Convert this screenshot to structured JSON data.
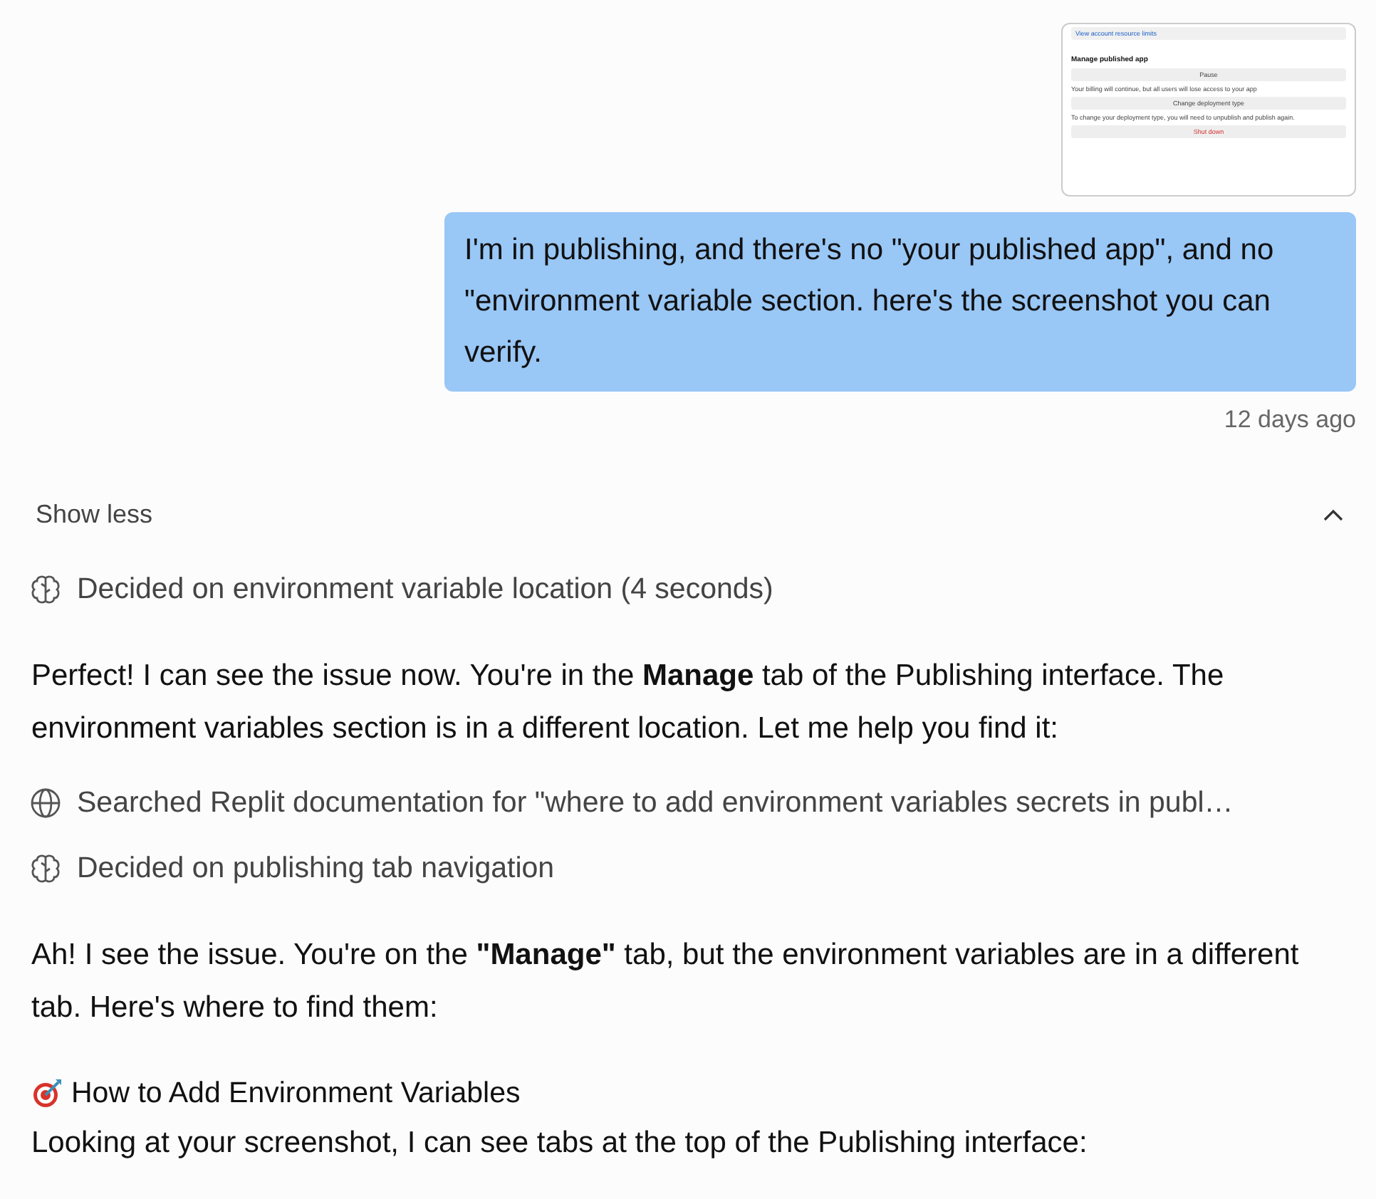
{
  "attachment": {
    "link": "View account resource limits",
    "heading": "Manage published app",
    "items": [
      {
        "button": "Pause",
        "note": "Your billing will continue, but all users will lose access to your app"
      },
      {
        "button": "Change deployment type",
        "note": "To change your deployment type, you will need to unpublish and publish again."
      },
      {
        "button": "Shut down",
        "danger": true
      }
    ]
  },
  "user_message": {
    "text": "I'm in publishing, and there's no \"your published app\", and no \"environment variable section. here's the screenshot you can verify.",
    "time": "12 days ago"
  },
  "toggle": {
    "label": "Show less",
    "expanded": true
  },
  "steps": [
    {
      "kind": "thought",
      "text": "Decided on environment variable location (4 seconds)"
    },
    {
      "kind": "paragraph",
      "text": "Perfect! I can see the issue now. You're in the **Manage** tab of the Publishing interface. The environment variables section is in a different location. Let me help you find it:"
    },
    {
      "kind": "search",
      "text": "Searched Replit documentation for \"where to add environment variables secrets in publ…"
    },
    {
      "kind": "thought",
      "text": "Decided on publishing tab navigation"
    },
    {
      "kind": "paragraph",
      "text": "Ah! I see the issue. You're on the **\"Manage\"** tab, but the environment variables are in a different tab. Here's where to find them:"
    },
    {
      "kind": "heading",
      "text": "How to Add Environment Variables"
    },
    {
      "kind": "paragraph",
      "text": "Looking at your screenshot, I can see tabs at the top of the Publishing interface:"
    }
  ]
}
